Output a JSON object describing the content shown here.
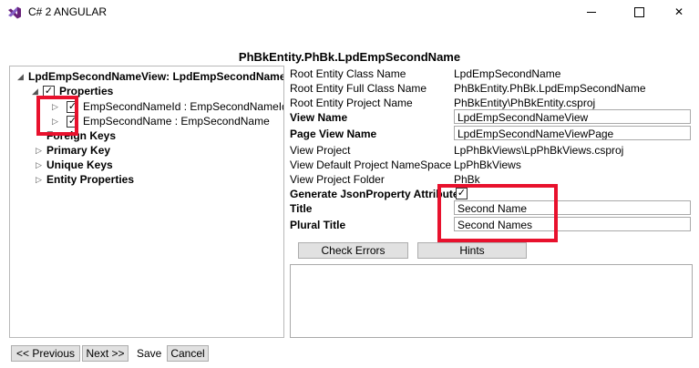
{
  "window": {
    "title": "C# 2 ANGULAR",
    "minimize_glyph": "—",
    "maximize_glyph": "☐",
    "close_glyph": "✕",
    "app_icon": "visual-studio-icon",
    "accent_color": "#68217a"
  },
  "heading": "PhBkEntity.PhBk.LpdEmpSecondName",
  "tree": {
    "root": "LpdEmpSecondNameView: LpdEmpSecondName",
    "properties": "Properties",
    "prop_items": [
      "EmpSecondNameId : EmpSecondNameId",
      "EmpSecondName : EmpSecondName"
    ],
    "foreign_keys": "Foreign Keys",
    "primary_key": "Primary Key",
    "unique_keys": "Unique Keys",
    "entity_properties": "Entity Properties",
    "expanded_glyph": "◢",
    "collapsed_glyph": "▷",
    "check_glyph": "✓"
  },
  "props": {
    "root_class_label": "Root Entity Class Name",
    "root_class_value": "LpdEmpSecondName",
    "root_full_label": "Root Entity Full Class Name",
    "root_full_value": "PhBkEntity.PhBk.LpdEmpSecondName",
    "root_project_label": "Root Entity Project Name",
    "root_project_value": "PhBkEntity\\PhBkEntity.csproj",
    "view_name_label": "View Name",
    "view_name_value": "LpdEmpSecondNameView",
    "page_view_label": "Page View Name",
    "page_view_value": "LpdEmpSecondNameViewPage",
    "view_project_label": "View Project",
    "view_project_value": "LpPhBkViews\\LpPhBkViews.csproj",
    "view_ns_label": "View Default Project NameSpace",
    "view_ns_value": "LpPhBkViews",
    "view_folder_label": "View Project Folder",
    "view_folder_value": "PhBk",
    "gen_json_label": "Generate JsonProperty Attribute",
    "gen_json_check": "✓",
    "title_label": "Title",
    "title_value": "Second Name",
    "plural_label": "Plural Title",
    "plural_value": "Second Names"
  },
  "buttons": {
    "check_errors": "Check Errors",
    "hints": "Hints",
    "previous": "<< Previous",
    "next": "Next >>",
    "save": "Save",
    "cancel": "Cancel"
  },
  "highlight_color": "#e8112d"
}
